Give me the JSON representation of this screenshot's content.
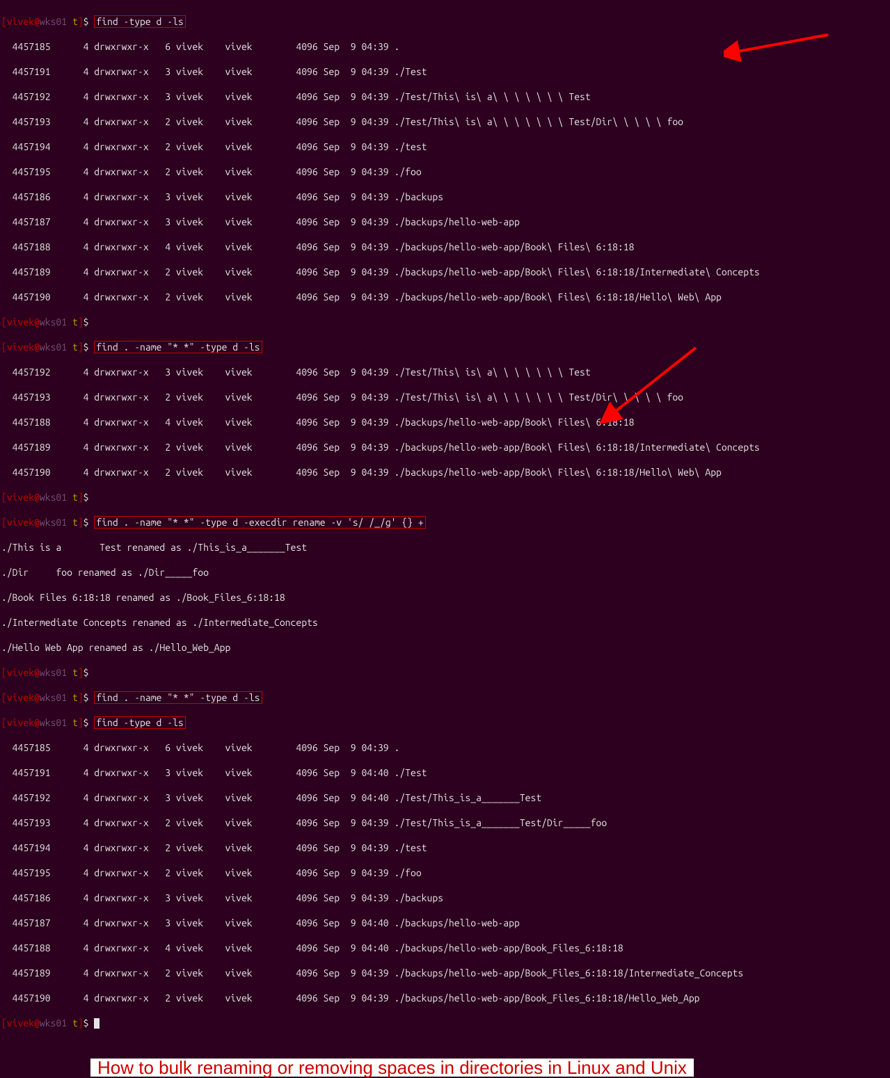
{
  "prompt": {
    "user": "vivek",
    "host": "wks01",
    "path": "t",
    "dollar": "$"
  },
  "commands": {
    "cmd1": "find -type d -ls",
    "cmd2": "find . -name \"* *\" -type d -ls",
    "cmd3": "find . -name \"* *\" -type d -execdir rename -v 's/ /_/g' {} +",
    "cmd4": "find . -name \"* *\" -type d -ls",
    "cmd5": "find -type d -ls"
  },
  "listing1": [
    "  4457185      4 drwxrwxr-x   6 vivek    vivek        4096 Sep  9 04:39 .",
    "  4457191      4 drwxrwxr-x   3 vivek    vivek        4096 Sep  9 04:39 ./Test",
    "  4457192      4 drwxrwxr-x   3 vivek    vivek        4096 Sep  9 04:39 ./Test/This\\ is\\ a\\ \\ \\ \\ \\ \\ \\ Test",
    "  4457193      4 drwxrwxr-x   2 vivek    vivek        4096 Sep  9 04:39 ./Test/This\\ is\\ a\\ \\ \\ \\ \\ \\ \\ Test/Dir\\ \\ \\ \\ \\ foo",
    "  4457194      4 drwxrwxr-x   2 vivek    vivek        4096 Sep  9 04:39 ./test",
    "  4457195      4 drwxrwxr-x   2 vivek    vivek        4096 Sep  9 04:39 ./foo",
    "  4457186      4 drwxrwxr-x   3 vivek    vivek        4096 Sep  9 04:39 ./backups",
    "  4457187      4 drwxrwxr-x   3 vivek    vivek        4096 Sep  9 04:39 ./backups/hello-web-app",
    "  4457188      4 drwxrwxr-x   4 vivek    vivek        4096 Sep  9 04:39 ./backups/hello-web-app/Book\\ Files\\ 6:18:18",
    "  4457189      4 drwxrwxr-x   2 vivek    vivek        4096 Sep  9 04:39 ./backups/hello-web-app/Book\\ Files\\ 6:18:18/Intermediate\\ Concepts",
    "  4457190      4 drwxrwxr-x   2 vivek    vivek        4096 Sep  9 04:39 ./backups/hello-web-app/Book\\ Files\\ 6:18:18/Hello\\ Web\\ App"
  ],
  "listing2": [
    "  4457192      4 drwxrwxr-x   3 vivek    vivek        4096 Sep  9 04:39 ./Test/This\\ is\\ a\\ \\ \\ \\ \\ \\ \\ Test",
    "  4457193      4 drwxrwxr-x   2 vivek    vivek        4096 Sep  9 04:39 ./Test/This\\ is\\ a\\ \\ \\ \\ \\ \\ \\ Test/Dir\\ \\ \\ \\ \\ foo",
    "  4457188      4 drwxrwxr-x   4 vivek    vivek        4096 Sep  9 04:39 ./backups/hello-web-app/Book\\ Files\\ 6:18:18",
    "  4457189      4 drwxrwxr-x   2 vivek    vivek        4096 Sep  9 04:39 ./backups/hello-web-app/Book\\ Files\\ 6:18:18/Intermediate\\ Concepts",
    "  4457190      4 drwxrwxr-x   2 vivek    vivek        4096 Sep  9 04:39 ./backups/hello-web-app/Book\\ Files\\ 6:18:18/Hello\\ Web\\ App"
  ],
  "rename_output": [
    "./This is a       Test renamed as ./This_is_a_______Test",
    "./Dir     foo renamed as ./Dir_____foo",
    "./Book Files 6:18:18 renamed as ./Book_Files_6:18:18",
    "./Intermediate Concepts renamed as ./Intermediate_Concepts",
    "./Hello Web App renamed as ./Hello_Web_App"
  ],
  "listing3": [
    "  4457185      4 drwxrwxr-x   6 vivek    vivek        4096 Sep  9 04:39 .",
    "  4457191      4 drwxrwxr-x   3 vivek    vivek        4096 Sep  9 04:40 ./Test",
    "  4457192      4 drwxrwxr-x   3 vivek    vivek        4096 Sep  9 04:40 ./Test/This_is_a_______Test",
    "  4457193      4 drwxrwxr-x   2 vivek    vivek        4096 Sep  9 04:39 ./Test/This_is_a_______Test/Dir_____foo",
    "  4457194      4 drwxrwxr-x   2 vivek    vivek        4096 Sep  9 04:39 ./test",
    "  4457195      4 drwxrwxr-x   2 vivek    vivek        4096 Sep  9 04:39 ./foo",
    "  4457186      4 drwxrwxr-x   3 vivek    vivek        4096 Sep  9 04:39 ./backups",
    "  4457187      4 drwxrwxr-x   3 vivek    vivek        4096 Sep  9 04:40 ./backups/hello-web-app",
    "  4457188      4 drwxrwxr-x   4 vivek    vivek        4096 Sep  9 04:40 ./backups/hello-web-app/Book_Files_6:18:18",
    "  4457189      4 drwxrwxr-x   2 vivek    vivek        4096 Sep  9 04:39 ./backups/hello-web-app/Book_Files_6:18:18/Intermediate_Concepts",
    "  4457190      4 drwxrwxr-x   2 vivek    vivek        4096 Sep  9 04:39 ./backups/hello-web-app/Book_Files_6:18:18/Hello_Web_App"
  ],
  "title": "How to bulk renaming or removing spaces in directories in Linux and Unix"
}
